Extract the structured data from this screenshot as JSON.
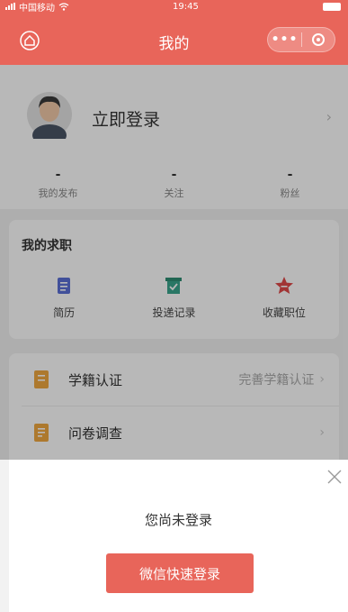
{
  "status_bar": {
    "carrier": "中国移动",
    "time": "19:45"
  },
  "nav": {
    "title": "我的",
    "more_label": "•••"
  },
  "profile": {
    "login_text": "立即登录",
    "chevron": "›",
    "stats": [
      {
        "value": "-",
        "label": "我的发布"
      },
      {
        "value": "-",
        "label": "关注"
      },
      {
        "value": "-",
        "label": "粉丝"
      }
    ]
  },
  "jobs": {
    "title": "我的求职",
    "items": [
      {
        "label": "简历",
        "icon": "resume-icon"
      },
      {
        "label": "投递记录",
        "icon": "delivery-record-icon"
      },
      {
        "label": "收藏职位",
        "icon": "favorite-star-icon"
      }
    ]
  },
  "list": [
    {
      "label": "学籍认证",
      "right": "完善学籍认证",
      "chevron": "›",
      "icon": "student-id-icon"
    },
    {
      "label": "问卷调查",
      "right": "",
      "chevron": "›",
      "icon": "survey-icon"
    }
  ],
  "login_sheet": {
    "title": "您尚未登录",
    "button_label": "微信快速登录",
    "close": "×"
  },
  "colors": {
    "brand": "#e8655a",
    "resume": "#5b6fd6",
    "record": "#3aa58c",
    "star": "#e04848",
    "list_icon": "#f0a840"
  }
}
